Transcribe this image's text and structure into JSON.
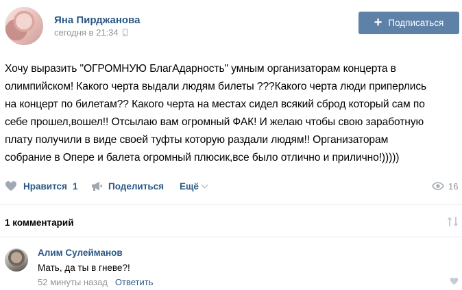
{
  "post": {
    "author_name": "Яна Пирджанова",
    "time": "сегодня в 21:34",
    "subscribe_label": "Подписаться",
    "text": "Хочу выразить \"ОГРОМНУЮ БлагАдарность\" умным организаторам концерта в\nолимпийском! Какого черта выдали людям билеты ???Какого черта люди приперлись\nна концерт по билетам?? Какого черта на местах сидел всякий сброд который сам по\nсебе прошел,вошел!! Отсылаю вам огромный ФАК! И желаю чтобы свою заработную\nплату получили в виде своей туфты которую раздали людям!! Организаторам\nсобрание в Опере и балета огромный плюсик,все было отлично и прилично!)))))"
  },
  "actions": {
    "like_label": "Нравится",
    "like_count": "1",
    "share_label": "Поделиться",
    "more_label": "Ещё",
    "views_count": "16"
  },
  "comments": {
    "count_label": "1 комментарий",
    "items": [
      {
        "author": "Алим Сулейманов",
        "text": "Мать, да ты в гневе?!",
        "time": "52 минуты назад",
        "reply_label": "Ответить"
      }
    ]
  },
  "colors": {
    "link": "#2a5885",
    "button": "#5e81a8",
    "muted": "#939393",
    "icon": "#a0a8b2"
  }
}
